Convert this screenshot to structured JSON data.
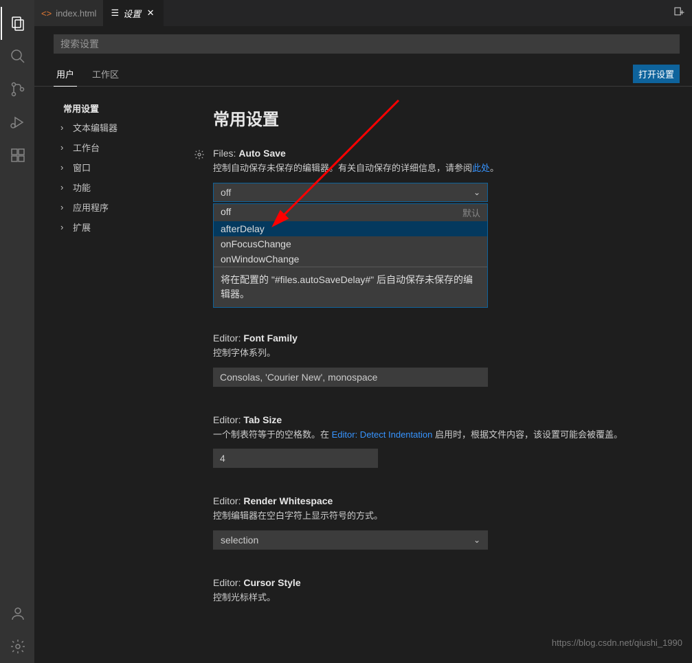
{
  "tabs": {
    "file": {
      "label": "index.html"
    },
    "settings": {
      "label": "设置"
    }
  },
  "search": {
    "placeholder": "搜索设置"
  },
  "scope": {
    "user": "用户",
    "workspace": "工作区",
    "open_button": "打开设置"
  },
  "toc": {
    "title": "常用设置",
    "items": [
      "文本编辑器",
      "工作台",
      "窗口",
      "功能",
      "应用程序",
      "扩展"
    ]
  },
  "heading": "常用设置",
  "settings": {
    "autoSave": {
      "scope": "Files:",
      "name": "Auto Save",
      "desc_pre": "控制自动保存未保存的编辑器。有关自动保存的详细信息，请参阅",
      "desc_link": "此处",
      "desc_post": "。",
      "value": "off",
      "options": [
        {
          "label": "off",
          "badge": "默认"
        },
        {
          "label": "afterDelay",
          "badge": ""
        },
        {
          "label": "onFocusChange",
          "badge": ""
        },
        {
          "label": "onWindowChange",
          "badge": ""
        }
      ],
      "hint": "将在配置的 \"#files.autoSaveDelay#\" 后自动保存未保存的编辑器。"
    },
    "fontFamily": {
      "scope": "Editor:",
      "name": "Font Family",
      "desc": "控制字体系列。",
      "value": "Consolas, 'Courier New', monospace"
    },
    "tabSize": {
      "scope": "Editor:",
      "name": "Tab Size",
      "desc_pre": "一个制表符等于的空格数。在 ",
      "desc_link": "Editor: Detect Indentation",
      "desc_post": " 启用时，根据文件内容，该设置可能会被覆盖。",
      "value": "4"
    },
    "renderWhitespace": {
      "scope": "Editor:",
      "name": "Render Whitespace",
      "desc": "控制编辑器在空白字符上显示符号的方式。",
      "value": "selection"
    },
    "cursorStyle": {
      "scope": "Editor:",
      "name": "Cursor Style",
      "desc": "控制光标样式。"
    }
  },
  "watermark": "https://blog.csdn.net/qiushi_1990"
}
